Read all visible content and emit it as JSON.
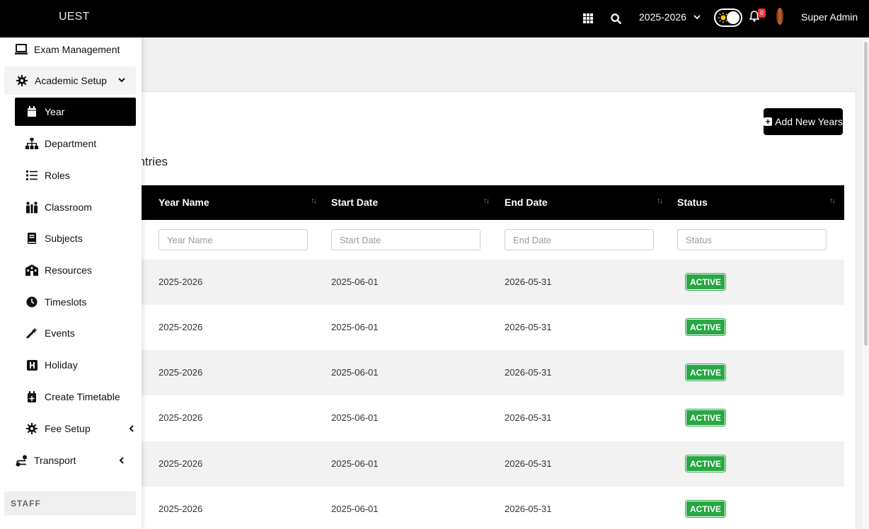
{
  "topbar": {
    "brand": "UEST",
    "academic_year": "2025-2026",
    "notification_count": "0",
    "user_name": "Super Admin"
  },
  "sidebar": {
    "exam_management": "Exam Management",
    "academic_setup": "Academic Setup",
    "sub_items": [
      {
        "label": "Year",
        "icon": "calendar-icon"
      },
      {
        "label": "Department",
        "icon": "sitemap-icon"
      },
      {
        "label": "Roles",
        "icon": "list-check-icon"
      },
      {
        "label": "Classroom",
        "icon": "people-icon"
      },
      {
        "label": "Subjects",
        "icon": "book-icon"
      },
      {
        "label": "Resources",
        "icon": "building-icon"
      },
      {
        "label": "Timeslots",
        "icon": "clock-icon"
      },
      {
        "label": "Events",
        "icon": "magic-wand-icon"
      },
      {
        "label": "Holiday",
        "icon": "h-square-icon"
      },
      {
        "label": "Create Timetable",
        "icon": "calendar-plus-icon"
      },
      {
        "label": "Fee Setup",
        "icon": "gear-icon"
      }
    ],
    "transport": "Transport",
    "section_staff": "STAFF"
  },
  "main": {
    "add_button": "Add New Years",
    "entries_text": "entries",
    "columns": [
      "Year Name",
      "Start Date",
      "End Date",
      "Status"
    ],
    "filters": [
      "Year Name",
      "Start Date",
      "End Date",
      "Status"
    ],
    "rows": [
      {
        "year": "2025-2026",
        "start": "2025-06-01",
        "end": "2026-05-31",
        "status": "ACTIVE"
      },
      {
        "year": "2025-2026",
        "start": "2025-06-01",
        "end": "2026-05-31",
        "status": "ACTIVE"
      },
      {
        "year": "2025-2026",
        "start": "2025-06-01",
        "end": "2026-05-31",
        "status": "ACTIVE"
      },
      {
        "year": "2025-2026",
        "start": "2025-06-01",
        "end": "2026-05-31",
        "status": "ACTIVE"
      },
      {
        "year": "2025-2026",
        "start": "2025-06-01",
        "end": "2026-05-31",
        "status": "ACTIVE"
      },
      {
        "year": "2025-2026",
        "start": "2025-06-01",
        "end": "2026-05-31",
        "status": "ACTIVE"
      }
    ]
  },
  "colors": {
    "topbar": "#000000",
    "status_active": "#28a745",
    "badge": "#e53935"
  }
}
